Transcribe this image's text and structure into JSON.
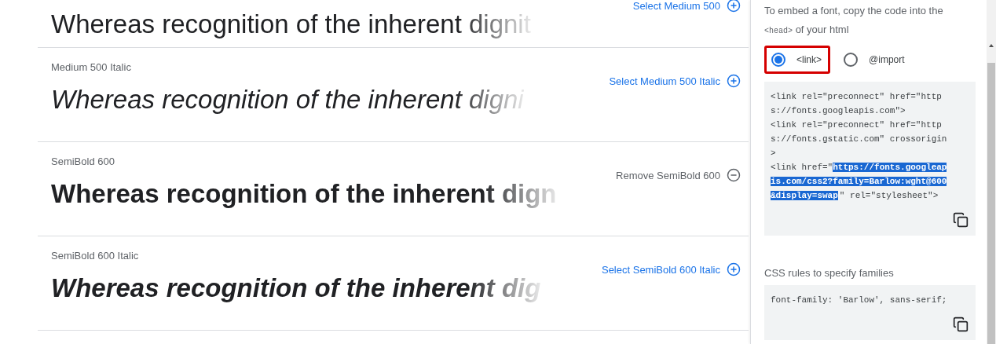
{
  "styles": [
    {
      "kind": "medium",
      "sample": "Whereas recognition of the inherent dignit",
      "action": "Select Medium 500",
      "selected": false
    },
    {
      "label": "Medium 500 Italic",
      "kind": "medium-italic",
      "sample": "Whereas recognition of the inherent digni",
      "action": "Select Medium 500 Italic",
      "selected": false
    },
    {
      "label": "SemiBold 600",
      "kind": "semibold",
      "sample": "Whereas recognition of the inherent dign",
      "action": "Remove SemiBold 600",
      "selected": true
    },
    {
      "label": "SemiBold 600 Italic",
      "kind": "semibold-italic",
      "sample": "Whereas recognition of the inherent dig",
      "action": "Select SemiBold 600 Italic",
      "selected": false
    }
  ],
  "embed": {
    "intro": "To embed a font, copy the code into the",
    "intro_code": "<head>",
    "intro_after": "of your html",
    "options": [
      {
        "label": "<link>",
        "selected": true,
        "kind": "boxed"
      },
      {
        "label": "@import",
        "selected": false,
        "kind": "plain"
      }
    ],
    "code_lines": [
      [
        {
          "text": "<link rel=\"preconnect\" href=\"http",
          "highlighted": false
        }
      ],
      [
        {
          "text": "s://fonts.googleapis.com\">",
          "highlighted": false
        }
      ],
      [
        {
          "text": "<link rel=\"preconnect\" href=\"http",
          "highlighted": false
        }
      ],
      [
        {
          "text": "s://fonts.gstatic.com\" crossorigin",
          "highlighted": false
        }
      ],
      [
        {
          "text": ">",
          "highlighted": false
        }
      ],
      [
        {
          "text": "<link href=\"",
          "highlighted": false
        },
        {
          "text": "https://fonts.googleap",
          "highlighted": true
        }
      ],
      [
        {
          "text": "is.com/css2?family=Barlow:wght@600",
          "highlighted": true
        }
      ],
      [
        {
          "text": "&display=swap",
          "highlighted": true
        },
        {
          "text": "\" rel=\"stylesheet\">",
          "highlighted": false
        }
      ]
    ],
    "css_title": "CSS rules to specify families",
    "css_lines": [
      [
        {
          "text": "font-family: 'Barlow', sans-serif;",
          "highlighted": false
        }
      ]
    ]
  }
}
